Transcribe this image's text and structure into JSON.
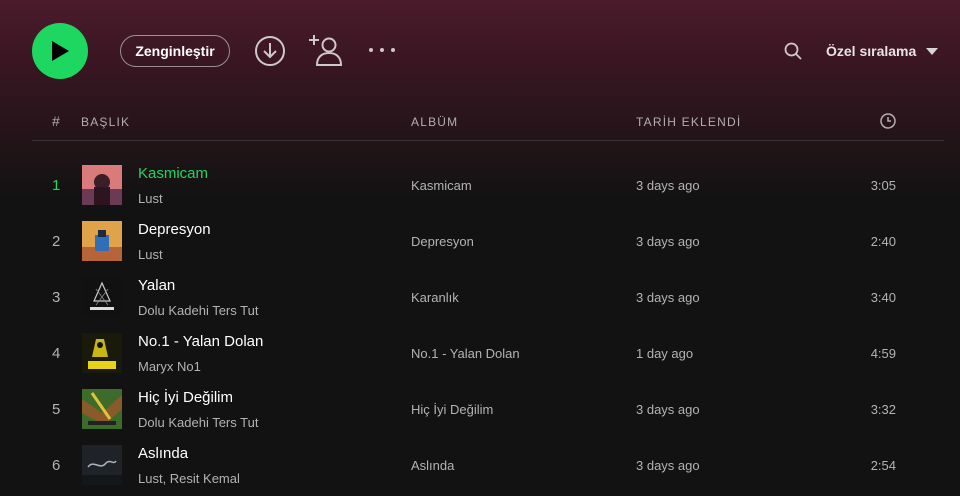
{
  "toolbar": {
    "play_icon": "play-icon",
    "enrich_label": "Zenginleştir",
    "download_icon": "download-circle-icon",
    "add_user_icon": "add-user-icon",
    "more_icon": "more-horizontal-icon",
    "search_icon": "search-icon",
    "sort_label": "Özel sıralama",
    "sort_caret_icon": "caret-down-icon",
    "accent_color": "#1ed760"
  },
  "table_header": {
    "num": "#",
    "title": "BAŞLIK",
    "album": "ALBÜM",
    "date_added": "TARİH EKLENDİ",
    "duration_icon": "clock-icon"
  },
  "tracks": [
    {
      "num": "1",
      "title": "Kasmicam",
      "artist": "Lust",
      "album": "Kasmicam",
      "date_added": "3 days ago",
      "duration": "3:05",
      "playing": true
    },
    {
      "num": "2",
      "title": "Depresyon",
      "artist": "Lust",
      "album": "Depresyon",
      "date_added": "3 days ago",
      "duration": "2:40",
      "playing": false
    },
    {
      "num": "3",
      "title": "Yalan",
      "artist": "Dolu Kadehi Ters Tut",
      "album": "Karanlık",
      "date_added": "3 days ago",
      "duration": "3:40",
      "playing": false
    },
    {
      "num": "4",
      "title": "No.1 - Yalan Dolan",
      "artist": "Maryx No1",
      "album": "No.1 - Yalan Dolan",
      "date_added": "1 day ago",
      "duration": "4:59",
      "playing": false
    },
    {
      "num": "5",
      "title": "Hiç İyi Değilim",
      "artist": "Dolu Kadehi Ters Tut",
      "album": "Hiç İyi Değilim",
      "date_added": "3 days ago",
      "duration": "3:32",
      "playing": false
    },
    {
      "num": "6",
      "title": "Aslında",
      "artist": "Lust, Resit Kemal",
      "album": "Aslında",
      "date_added": "3 days ago",
      "duration": "2:54",
      "playing": false
    }
  ]
}
